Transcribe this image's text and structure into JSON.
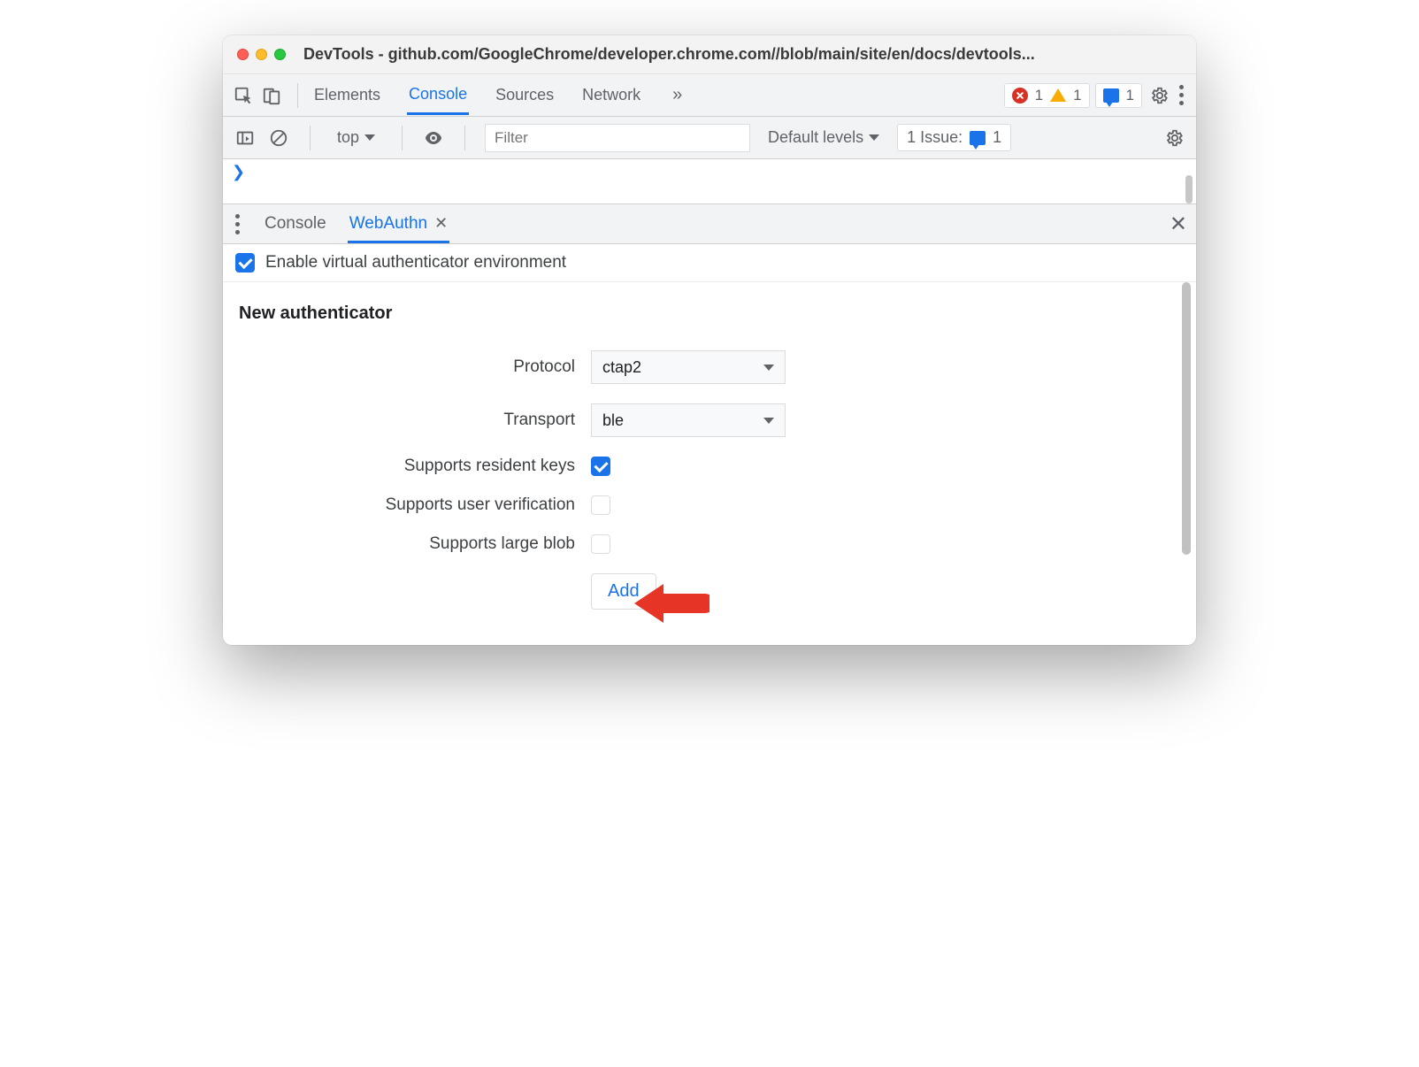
{
  "window": {
    "title": "DevTools - github.com/GoogleChrome/developer.chrome.com//blob/main/site/en/docs/devtools..."
  },
  "mainTabs": {
    "elements": "Elements",
    "console": "Console",
    "sources": "Sources",
    "network": "Network"
  },
  "badges": {
    "errors": "1",
    "warnings": "1",
    "messages": "1"
  },
  "consoleBar": {
    "context": "top",
    "filterPlaceholder": "Filter",
    "levels": "Default levels",
    "issuesLabel": "1 Issue:",
    "issuesCount": "1"
  },
  "drawer": {
    "tabs": {
      "console": "Console",
      "webauthn": "WebAuthn"
    },
    "enableLabel": "Enable virtual authenticator environment"
  },
  "authenticator": {
    "heading": "New authenticator",
    "protocolLabel": "Protocol",
    "protocolValue": "ctap2",
    "transportLabel": "Transport",
    "transportValue": "ble",
    "residentKeysLabel": "Supports resident keys",
    "userVerificationLabel": "Supports user verification",
    "largeBlobLabel": "Supports large blob",
    "addLabel": "Add"
  }
}
